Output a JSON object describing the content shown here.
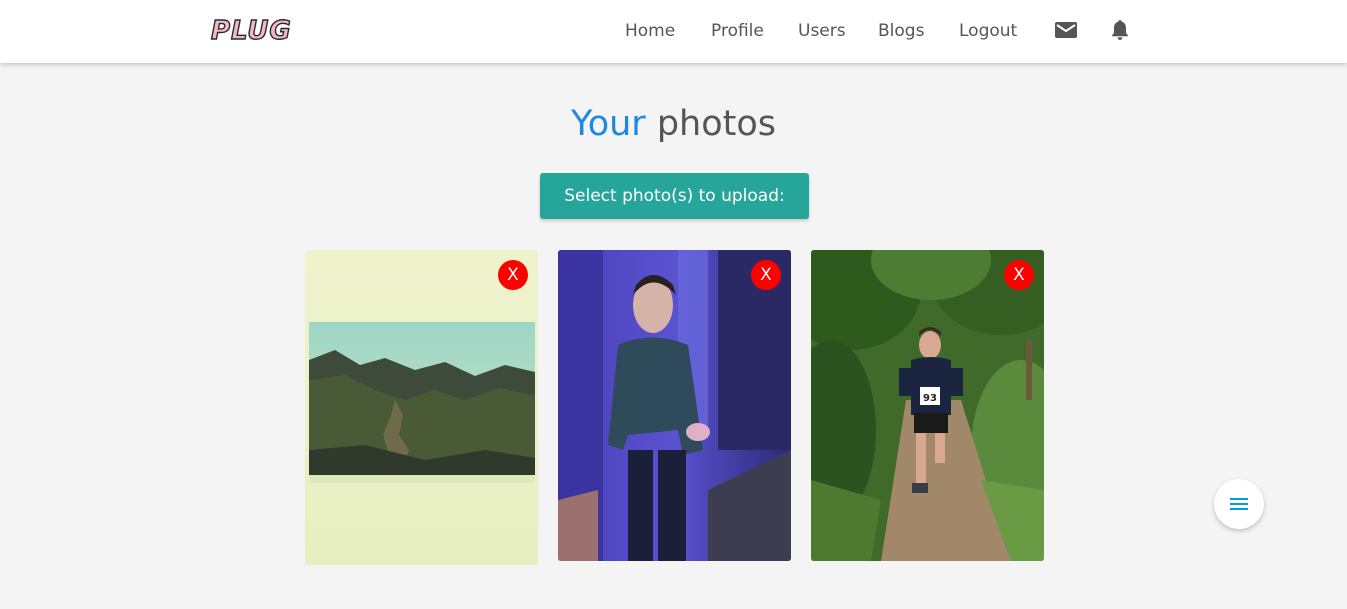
{
  "brand": {
    "logo_text": "PLUG"
  },
  "nav": {
    "links": [
      "Home",
      "Profile",
      "Users",
      "Blogs",
      "Logout"
    ],
    "icons": [
      "mail-icon",
      "bell-icon"
    ]
  },
  "page": {
    "heading_accent": "Your",
    "heading_rest": "photos",
    "upload_button_label": "Select photo(s) to upload:"
  },
  "photos": [
    {
      "subject": "landscape-painting",
      "delete_label": "X"
    },
    {
      "subject": "man-in-sweater-purple-light",
      "delete_label": "X"
    },
    {
      "subject": "trail-runner-number-93",
      "bib_number": "93",
      "delete_label": "X"
    }
  ],
  "fab": {
    "icon": "menu-icon"
  },
  "colors": {
    "accent_blue": "#1e88e5",
    "button_teal": "#26a69a",
    "delete_red": "#ff0000",
    "fab_icon_blue": "#039be5"
  }
}
